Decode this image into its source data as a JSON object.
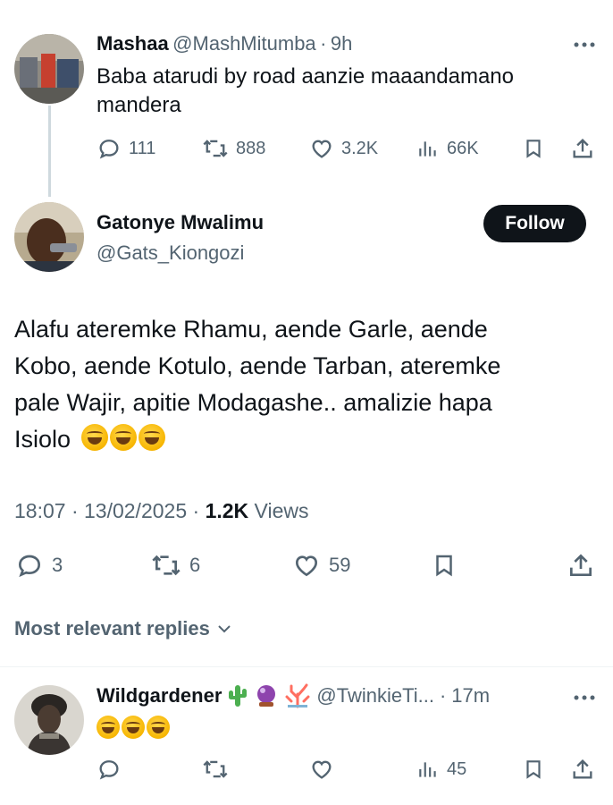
{
  "tweet1": {
    "name": "Mashaa",
    "handle": "@MashMitumba",
    "sep": "·",
    "time": "9h",
    "text_line1": "Baba atarudi by road aanzie maaandamano",
    "text_line2": "mandera",
    "replies": "111",
    "retweets": "888",
    "likes": "3.2K",
    "views": "66K"
  },
  "tweet2": {
    "name": "Gatonye Mwalimu",
    "handle": "@Gats_Kiongozi",
    "follow_label": "Follow",
    "text_line1": "Alafu ateremke Rhamu, aende Garle, aende",
    "text_line2": "Kobo, aende Kotulo, aende Tarban, ateremke",
    "text_line3": "pale Wajir, apitie Modagashe.. amalizie hapa",
    "text_line4": "Isiolo",
    "timestamp": "18:07 · 13/02/2025 ·",
    "view_count": "1.2K",
    "views_label": "Views",
    "replies": "3",
    "retweets": "6",
    "likes": "59"
  },
  "replies_sort": {
    "label": "Most relevant replies"
  },
  "tweet3": {
    "name": "Wildgardener",
    "handle": "@TwinkieTi...",
    "sep": "·",
    "time": "17m",
    "views": "45"
  },
  "icons": {
    "more": "more-icon",
    "reply": "reply-icon",
    "retweet": "retweet-icon",
    "like": "heart-icon",
    "views": "views-icon",
    "bookmark": "bookmark-icon",
    "share": "share-icon"
  }
}
